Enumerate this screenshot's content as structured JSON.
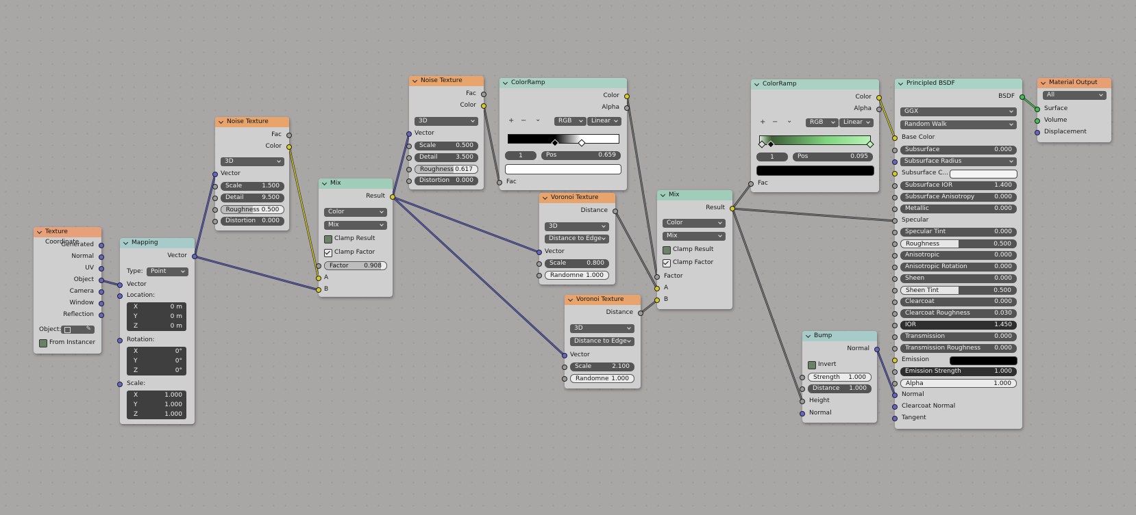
{
  "texcoord": {
    "title": "Texture Coordinate",
    "outputs": [
      "Generated",
      "Normal",
      "UV",
      "Object",
      "Camera",
      "Window",
      "Reflection"
    ],
    "object_label": "Object:",
    "from_instancer": "From Instancer"
  },
  "mapping": {
    "title": "Mapping",
    "out": "Vector",
    "type_label": "Type:",
    "type_value": "Point",
    "vector": "Vector",
    "location": "Location:",
    "rotation": "Rotation:",
    "scale": "Scale:",
    "axes": [
      "X",
      "Y",
      "Z"
    ],
    "loc": [
      "0 m",
      "0 m",
      "0 m"
    ],
    "rot": [
      "0°",
      "0°",
      "0°"
    ],
    "scl": [
      "1.000",
      "1.000",
      "1.000"
    ]
  },
  "noise1": {
    "title": "Noise Texture",
    "out_fac": "Fac",
    "out_color": "Color",
    "dim": "3D",
    "vector": "Vector",
    "scale_l": "Scale",
    "scale_v": "1.500",
    "detail_l": "Detail",
    "detail_v": "9.500",
    "rough_l": "Roughness",
    "rough_v": "0.500",
    "rough_f": 0.5,
    "dist_l": "Distortion",
    "dist_v": "0.000"
  },
  "mix1": {
    "title": "Mix",
    "result": "Result",
    "dtype": "Color",
    "blend": "Mix",
    "clamp_result": "Clamp Result",
    "clamp_factor": "Clamp Factor",
    "factor_l": "Factor",
    "factor_v": "0.908",
    "factor_f": 0.908,
    "a": "A",
    "b": "B"
  },
  "noise2": {
    "title": "Noise Texture",
    "out_fac": "Fac",
    "out_color": "Color",
    "dim": "3D",
    "vector": "Vector",
    "scale_l": "Scale",
    "scale_v": "0.500",
    "detail_l": "Detail",
    "detail_v": "3.500",
    "rough_l": "Roughness",
    "rough_v": "0.617",
    "rough_f": 0.617,
    "dist_l": "Distortion",
    "dist_v": "0.000"
  },
  "ramp1": {
    "title": "ColorRamp",
    "out_color": "Color",
    "out_alpha": "Alpha",
    "plus": "+",
    "minus": "−",
    "menu": "⌄",
    "mode": "RGB",
    "interp": "Linear",
    "index": "1",
    "pos_l": "Pos",
    "pos_v": "0.659",
    "fac": "Fac",
    "swatch": "#ffffff"
  },
  "vor1": {
    "title": "Voronoi Texture",
    "out_dist": "Distance",
    "dim": "3D",
    "feature": "Distance to Edge",
    "vector": "Vector",
    "scale_l": "Scale",
    "scale_v": "0.800",
    "rand_l": "Randomne",
    "rand_v": "1.000"
  },
  "vor2": {
    "title": "Voronoi Texture",
    "out_dist": "Distance",
    "dim": "3D",
    "feature": "Distance to Edge",
    "vector": "Vector",
    "scale_l": "Scale",
    "scale_v": "2.100",
    "rand_l": "Randomne",
    "rand_v": "1.000"
  },
  "mix2": {
    "title": "Mix",
    "result": "Result",
    "dtype": "Color",
    "blend": "Mix",
    "clamp_result": "Clamp Result",
    "clamp_factor": "Clamp Factor",
    "factor": "Factor",
    "a": "A",
    "b": "B"
  },
  "ramp2": {
    "title": "ColorRamp",
    "out_color": "Color",
    "out_alpha": "Alpha",
    "plus": "+",
    "minus": "−",
    "menu": "⌄",
    "mode": "RGB",
    "interp": "Linear",
    "index": "1",
    "pos_l": "Pos",
    "pos_v": "0.095",
    "fac": "Fac",
    "swatch": "#000000"
  },
  "bump": {
    "title": "Bump",
    "out_normal": "Normal",
    "invert": "Invert",
    "strength_l": "Strength",
    "strength_v": "1.000",
    "distance_l": "Distance",
    "distance_v": "1.000",
    "height": "Height",
    "normal": "Normal"
  },
  "bsdf": {
    "title": "Principled BSDF",
    "out": "BSDF",
    "distribution": "GGX",
    "sss_method": "Random Walk",
    "base_color": "Base Color",
    "subsurface_l": "Subsurface",
    "subsurface_v": "0.000",
    "radius": "Subsurface Radius",
    "sss_color": "Subsurface C...",
    "sss_ior_l": "Subsurface IOR",
    "sss_ior_v": "1.400",
    "sss_aniso_l": "Subsurface Anisotropy",
    "sss_aniso_v": "0.000",
    "metallic_l": "Metallic",
    "metallic_v": "0.000",
    "specular": "Specular",
    "spec_tint_l": "Specular Tint",
    "spec_tint_v": "0.000",
    "rough_l": "Roughness",
    "rough_v": "0.500",
    "rough_f": 0.5,
    "aniso_l": "Anisotropic",
    "aniso_v": "0.000",
    "aniso_rot_l": "Anisotropic Rotation",
    "aniso_rot_v": "0.000",
    "sheen_l": "Sheen",
    "sheen_v": "0.000",
    "sheen_tint_l": "Sheen Tint",
    "sheen_tint_v": "0.500",
    "sheen_tint_f": 0.5,
    "clearcoat_l": "Clearcoat",
    "clearcoat_v": "0.000",
    "cc_rough_l": "Clearcoat Roughness",
    "cc_rough_v": "0.030",
    "ior_l": "IOR",
    "ior_v": "1.450",
    "trans_l": "Transmission",
    "trans_v": "0.000",
    "trans_rough_l": "Transmission Roughness",
    "trans_rough_v": "0.000",
    "emission": "Emission",
    "emission_color": "#000000",
    "em_str_l": "Emission Strength",
    "em_str_v": "1.000",
    "alpha_l": "Alpha",
    "alpha_v": "1.000",
    "normal": "Normal",
    "cc_normal": "Clearcoat Normal",
    "tangent": "Tangent"
  },
  "output": {
    "title": "Material Output",
    "target": "All",
    "surface": "Surface",
    "volume": "Volume",
    "displacement": "Displacement"
  }
}
